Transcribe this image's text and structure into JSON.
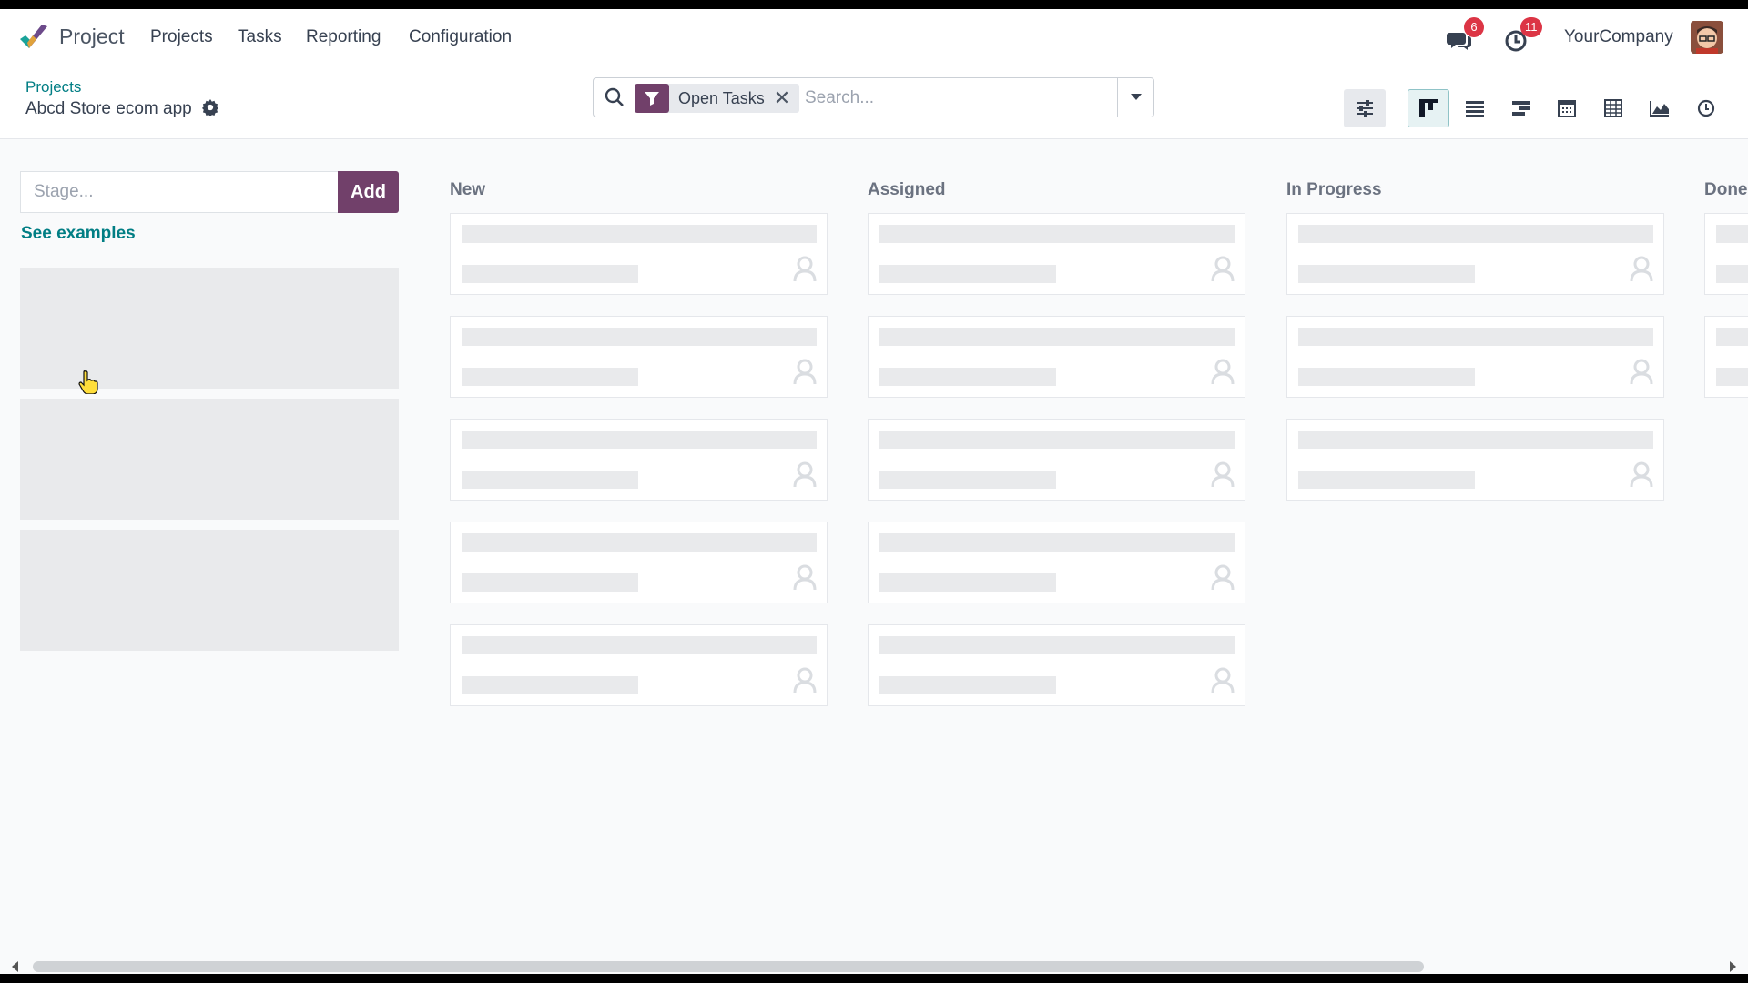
{
  "nav": {
    "app_name": "Project",
    "menus": [
      "Projects",
      "Tasks",
      "Reporting",
      "Configuration"
    ],
    "messages_count": "6",
    "activities_count": "11",
    "company": "YourCompany"
  },
  "breadcrumb": {
    "parent": "Projects",
    "current": "Abcd Store ecom app"
  },
  "search": {
    "facet_label": "Open Tasks",
    "placeholder": "Search..."
  },
  "views": [
    "kanban",
    "list",
    "gantt",
    "calendar",
    "pivot",
    "graph",
    "activity"
  ],
  "active_view": "kanban",
  "stage_create": {
    "placeholder": "Stage...",
    "add_label": "Add",
    "examples_link": "See examples"
  },
  "columns": [
    {
      "title": "New",
      "placeholder_cards": 5
    },
    {
      "title": "Assigned",
      "placeholder_cards": 5
    },
    {
      "title": "In Progress",
      "placeholder_cards": 3
    },
    {
      "title": "Done",
      "placeholder_cards": 2
    }
  ],
  "colors": {
    "accent": "#71406a",
    "link": "#017e84",
    "badge": "#dc3545"
  }
}
